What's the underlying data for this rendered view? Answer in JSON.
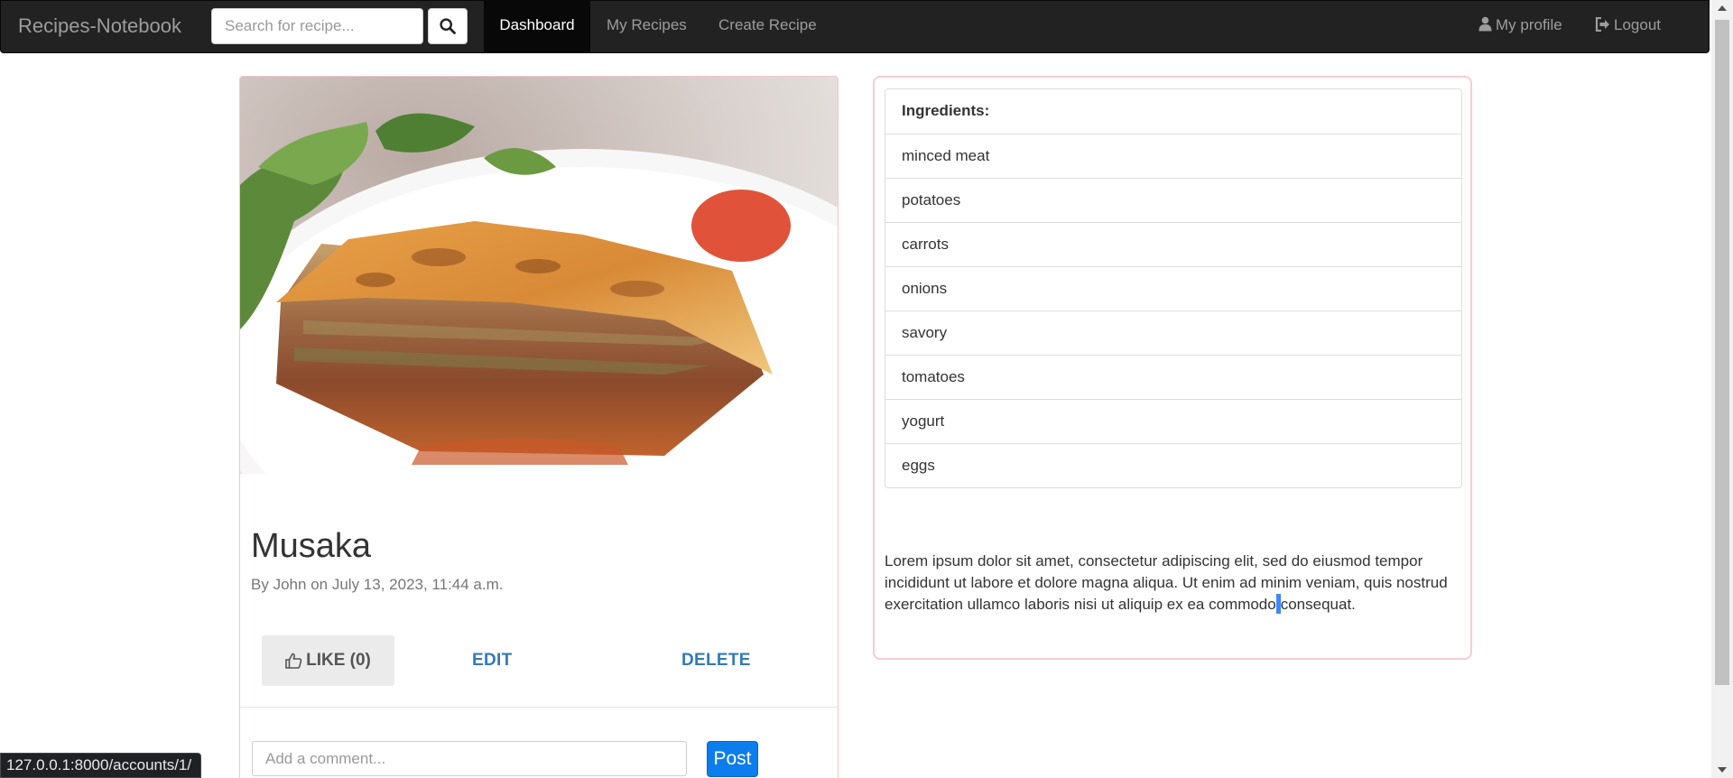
{
  "navbar": {
    "brand": "Recipes-Notebook",
    "search_placeholder": "Search for recipe...",
    "search_icon": "search-icon",
    "links": {
      "dashboard": "Dashboard",
      "my_recipes": "My Recipes",
      "create_recipe": "Create Recipe",
      "my_profile": "My profile",
      "logout": "Logout"
    },
    "active": "Dashboard"
  },
  "recipe": {
    "title": "Musaka",
    "by_label": "By",
    "author": "John",
    "on_label": "on",
    "date": "July 13, 2023, 11:44 a.m.",
    "actions": {
      "like": "LIKE (0)",
      "edit": "EDIT",
      "delete": "DELETE"
    }
  },
  "ingredients": {
    "header": "Ingredients:",
    "items": [
      "minced meat",
      "potatoes",
      "carrots",
      "onions",
      "savory",
      "tomatoes",
      "yogurt",
      "eggs"
    ]
  },
  "description": {
    "before_caret": "Lorem ipsum dolor sit amet, consectetur adipiscing elit, sed do eiusmod tempor incididunt ut labore et dolore magna aliqua. Ut enim ad minim veniam, quis nostrud exercitation ullamco laboris nisi ut aliquip ex ea commodo",
    "after_caret": "consequat."
  },
  "comment": {
    "placeholder": "Add a comment...",
    "post_label": "Post"
  },
  "statusbar": {
    "url": "127.0.0.1:8000/accounts/1/"
  },
  "colors": {
    "navbar_bg": "#222222",
    "link_blue": "#337ab7",
    "post_blue": "#0b7dec",
    "card_border": "#f0c6cc"
  }
}
